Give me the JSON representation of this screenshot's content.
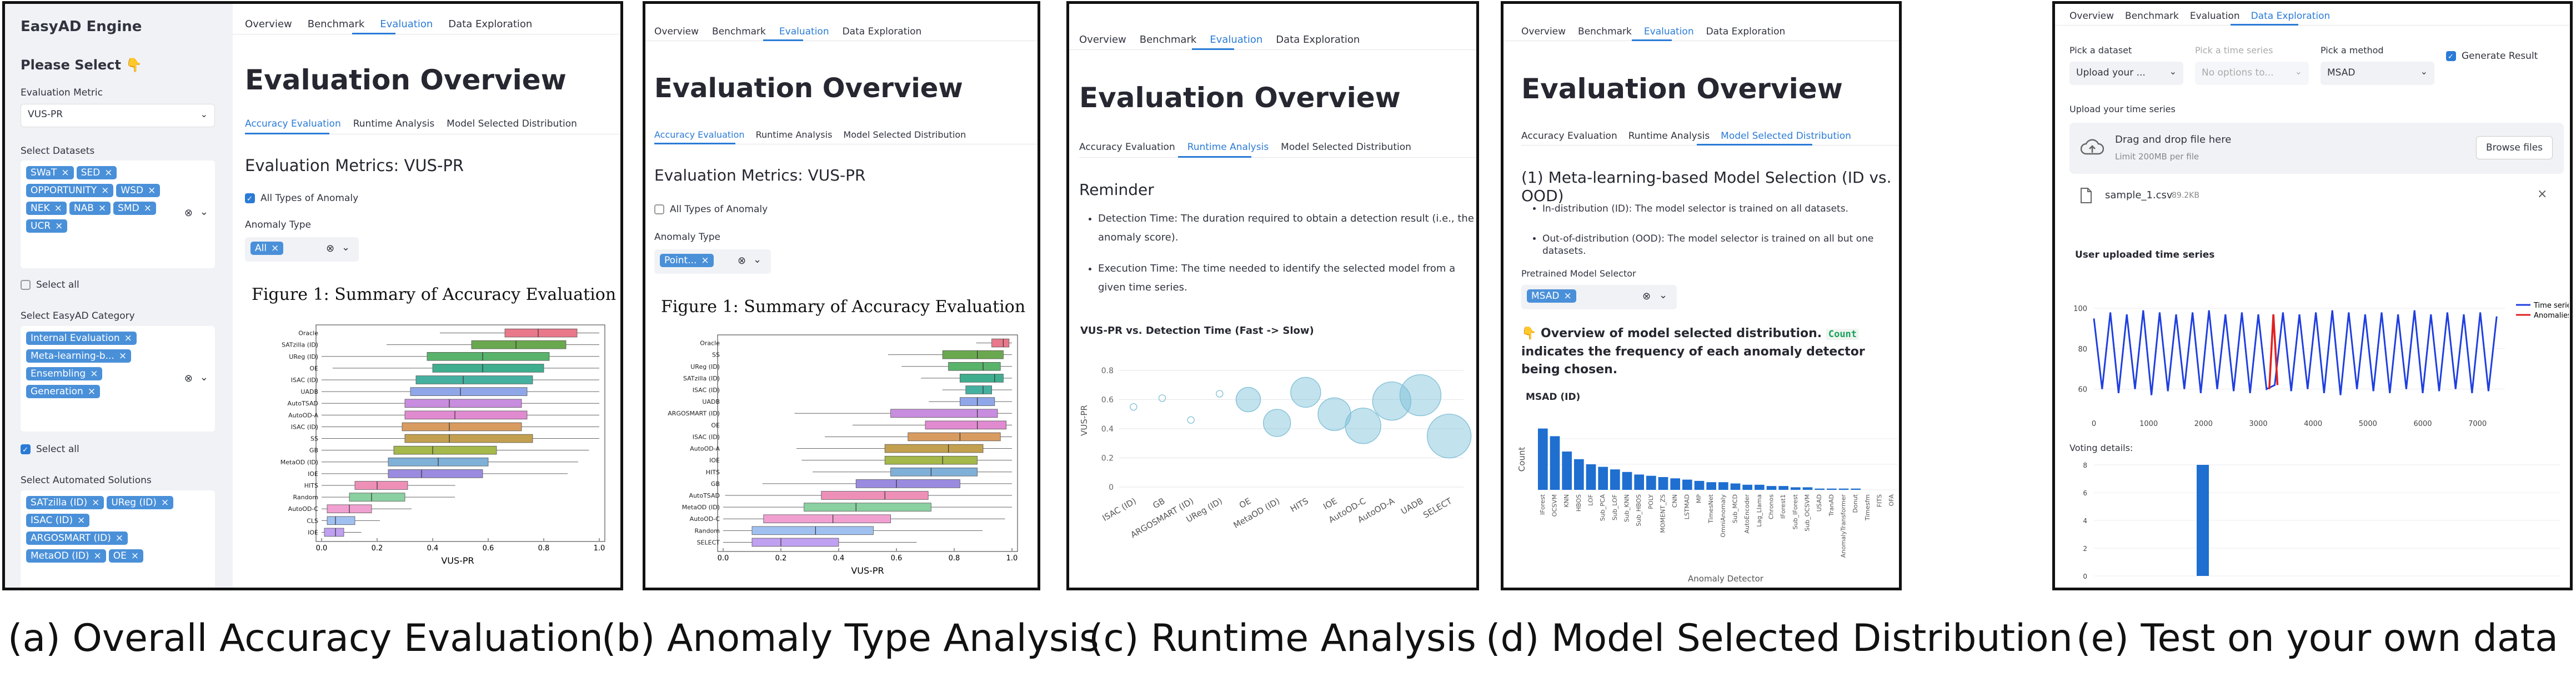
{
  "common": {
    "nav": [
      "Overview",
      "Benchmark",
      "Evaluation",
      "Data Exploration"
    ],
    "page_title": "Evaluation Overview",
    "tabs": [
      "Accuracy Evaluation",
      "Runtime Analysis",
      "Model Selected Distribution"
    ],
    "figure_title": "Figure 1: Summary of Accuracy Evaluation",
    "x_axis_label": "VUS-PR"
  },
  "captions": [
    "(a) Overall Accuracy Evaluation",
    "(b) Anomaly Type Analysis",
    "(c) Runtime Analysis",
    "(d) Model Selected Distribution",
    "(e) Test on your own data"
  ],
  "panel_a": {
    "sidebar": {
      "app_title": "EasyAD Engine",
      "please_select": "Please Select 👇",
      "metric_label": "Evaluation Metric",
      "metric_value": "VUS-PR",
      "datasets_label": "Select Datasets",
      "datasets": [
        "SWaT",
        "SED",
        "OPPORTUNITY",
        "WSD",
        "NEK",
        "NAB",
        "SMD",
        "UCR"
      ],
      "select_all": "Select all",
      "category_label": "Select EasyAD Category",
      "categories": [
        "Internal Evaluation",
        "Meta-learning-b...",
        "Ensembling",
        "Generation"
      ],
      "solutions_label": "Select Automated Solutions",
      "solutions": [
        "SATzilla (ID)",
        "UReg (ID)",
        "ISAC (ID)",
        "ARGOSMART (ID)",
        "MetaOD (ID)",
        "OE"
      ]
    },
    "metrics_title": "Evaluation Metrics: VUS-PR",
    "all_types": "All Types of Anomaly",
    "anomaly_type_label": "Anomaly Type",
    "anomaly_type_value": "All",
    "x_ticks": [
      "0.0",
      "0.2",
      "0.4",
      "0.6",
      "0.8",
      "1.0"
    ]
  },
  "panel_b": {
    "metrics_title": "Evaluation Metrics: VUS-PR",
    "all_types": "All Types of Anomaly",
    "anomaly_type_label": "Anomaly Type",
    "anomaly_type_value": "Point...",
    "x_ticks": [
      "0.0",
      "0.2",
      "0.4",
      "0.6",
      "0.8",
      "1.0"
    ]
  },
  "panel_c": {
    "reminder_title": "Reminder",
    "bullets": [
      "Detection Time: The duration required to obtain a detection result (i.e., the anomaly score).",
      "Execution Time: The time needed to identify the selected model from a given time series."
    ],
    "chart_title": "VUS-PR vs. Detection Time (Fast -> Slow)",
    "y_label": "VUS-PR",
    "y_ticks": [
      "0",
      "0.2",
      "0.4",
      "0.6",
      "0.8"
    ],
    "x_labels": [
      "ISAC (ID)",
      "GB",
      "ARGOSMART (ID)",
      "UReg (ID)",
      "OE",
      "MetaOD (ID)",
      "HITS",
      "IOE",
      "AutoOD-C",
      "AutoOD-A",
      "UADB",
      "SELECT"
    ]
  },
  "panel_d": {
    "section_title": "(1) Meta-learning-based Model Selection (ID vs. OOD)",
    "bullets": [
      "In-distribution (ID): The model selector is trained on all datasets.",
      "Out-of-distribution (OOD): The model selector is trained on all but one datasets."
    ],
    "selector_label": "Pretrained Model Selector",
    "selector_value": "MSAD",
    "overview_pre": "👇 Overview of model selected distribution.",
    "overview_code": "Count",
    "overview_post": "indicates the frequency of each anomaly detector being chosen.",
    "chart_title": "MSAD (ID)",
    "y_label": "Count",
    "x_label": "Anomaly Detector"
  },
  "panel_e": {
    "nav_active": "Data Exploration",
    "pick_dataset_label": "Pick a dataset",
    "pick_dataset_value": "Upload your ...",
    "pick_time_series_label": "Pick a time series",
    "pick_time_series_value": "No options to...",
    "pick_method_label": "Pick a method",
    "pick_method_value": "MSAD",
    "generate_result": "Generate Result",
    "upload_label": "Upload your time series",
    "drag_text": "Drag and drop file here",
    "limit_text": "Limit 200MB per file",
    "browse_button": "Browse files",
    "file_name": "sample_1.csv",
    "file_size": "89.2KB",
    "ts_title": "User uploaded time series",
    "legend_ts": "Time series",
    "legend_anom": "Anomalies",
    "ts_y_ticks": [
      "100",
      "80",
      "60"
    ],
    "ts_x_ticks": [
      "0",
      "1000",
      "2000",
      "3000",
      "4000",
      "5000",
      "6000",
      "7000"
    ],
    "voting_label": "Voting details:",
    "vote_y_ticks": [
      "8",
      "6",
      "4",
      "2",
      "0"
    ]
  },
  "chart_data": [
    {
      "type": "box",
      "title": "Figure 1: Summary of Accuracy Evaluation",
      "xlabel": "VUS-PR",
      "xlim": [
        0,
        1
      ],
      "categories": [
        "Oracle",
        "SATzilla (ID)",
        "UReg (ID)",
        "OE",
        "ISAC (ID)",
        "UADB",
        "AutoTSAD",
        "AutoOD-A",
        "ISAC (ID)",
        "SS",
        "GB",
        "MetaOD (ID)",
        "IOE",
        "HITS",
        "Random",
        "AutoOD-C",
        "CLS",
        "IOE"
      ],
      "q1": [
        0.66,
        0.54,
        0.38,
        0.4,
        0.34,
        0.32,
        0.3,
        0.3,
        0.29,
        0.3,
        0.26,
        0.24,
        0.24,
        0.12,
        0.1,
        0.02,
        0.02,
        0.01
      ],
      "median": [
        0.78,
        0.7,
        0.58,
        0.58,
        0.51,
        0.5,
        0.46,
        0.48,
        0.46,
        0.46,
        0.4,
        0.42,
        0.36,
        0.2,
        0.18,
        0.1,
        0.05,
        0.05
      ],
      "q3": [
        0.92,
        0.88,
        0.82,
        0.8,
        0.76,
        0.74,
        0.72,
        0.74,
        0.72,
        0.76,
        0.63,
        0.6,
        0.58,
        0.31,
        0.3,
        0.18,
        0.12,
        0.08
      ]
    },
    {
      "type": "box",
      "title": "Figure 1: Summary of Accuracy Evaluation",
      "xlabel": "VUS-PR",
      "xlim": [
        0,
        1
      ],
      "categories": [
        "Oracle",
        "SS",
        "UReg (ID)",
        "SATzilla (ID)",
        "ISAC (ID)",
        "UADB",
        "ARGOSMART (ID)",
        "OE",
        "ISAC (ID)",
        "AutoOD-A",
        "IOE",
        "HITS",
        "GB",
        "AutoTSAD",
        "MetaOD (ID)",
        "AutoOD-C",
        "Random",
        "SELECT"
      ],
      "q1": [
        0.93,
        0.76,
        0.78,
        0.82,
        0.84,
        0.82,
        0.58,
        0.7,
        0.64,
        0.56,
        0.56,
        0.58,
        0.46,
        0.34,
        0.28,
        0.14,
        0.1,
        0.1
      ],
      "median": [
        0.97,
        0.88,
        0.9,
        0.94,
        0.9,
        0.88,
        0.88,
        0.88,
        0.82,
        0.78,
        0.76,
        0.72,
        0.6,
        0.56,
        0.46,
        0.38,
        0.32,
        0.2
      ],
      "q3": [
        0.99,
        0.97,
        0.96,
        0.97,
        0.93,
        0.94,
        0.95,
        0.98,
        0.96,
        0.9,
        0.88,
        0.88,
        0.82,
        0.71,
        0.72,
        0.58,
        0.52,
        0.4
      ]
    },
    {
      "type": "scatter",
      "title": "VUS-PR vs. Detection Time (Fast -> Slow)",
      "ylabel": "VUS-PR",
      "ylim": [
        0,
        0.8
      ],
      "categories": [
        "ISAC (ID)",
        "GB",
        "ARGOSMART (ID)",
        "UReg (ID)",
        "OE",
        "MetaOD (ID)",
        "HITS",
        "IOE",
        "AutoOD-C",
        "AutoOD-A",
        "UADB",
        "SELECT"
      ],
      "values": [
        0.55,
        0.61,
        0.46,
        0.64,
        0.6,
        0.44,
        0.65,
        0.5,
        0.42,
        0.59,
        0.63,
        0.35
      ]
    },
    {
      "type": "bar",
      "title": "MSAD (ID)",
      "ylabel": "Count",
      "xlabel": "Anomaly Detector",
      "categories": [
        "IForest",
        "OCSVM",
        "KNN",
        "HBOS",
        "LOF",
        "Sub_PCA",
        "Sub_LOF",
        "Sub_KNN",
        "Sub_HBOS",
        "POLY",
        "MOMENT_ZS",
        "CNN",
        "LSTMAD",
        "MP",
        "TimesNet",
        "OmniAnomaly",
        "Sub_MCD",
        "AutoEncoder",
        "Lag_Llama",
        "Chronos",
        "IForest1",
        "Sub_IForest",
        "Sub_OCSVM",
        "USAD",
        "TranAD",
        "AnomalyTransformer",
        "Donut",
        "Timesfm",
        "FITS",
        "OFA"
      ],
      "values": [
        48,
        42,
        30,
        24,
        20,
        18,
        16,
        14,
        12,
        11,
        10,
        9,
        8,
        7,
        6,
        6,
        5,
        4,
        4,
        3,
        3,
        2,
        2,
        1,
        1,
        1,
        1,
        0,
        0,
        0
      ]
    },
    {
      "type": "line",
      "title": "User uploaded time series",
      "series": [
        {
          "name": "Time series"
        },
        {
          "name": "Anomalies"
        }
      ],
      "xlim": [
        0,
        7500
      ],
      "ylim": [
        50,
        105
      ],
      "anomaly_x_range": [
        3200,
        3350
      ],
      "x": [
        0,
        150,
        300,
        450,
        600,
        750,
        900,
        1050,
        1200,
        1350,
        1500,
        1650,
        1800,
        1950,
        2100,
        2250,
        2400,
        2550,
        2700,
        2850,
        3000,
        3150,
        3300,
        3450,
        3600,
        3750,
        3900,
        4050,
        4200,
        4350,
        4500,
        4650,
        4800,
        4950,
        5100,
        5250,
        5400,
        5550,
        5700,
        5850,
        6000,
        6150,
        6300,
        6450,
        6600,
        6750,
        6900,
        7050,
        7200,
        7350
      ],
      "values": [
        95,
        60,
        98,
        58,
        97,
        60,
        99,
        57,
        98,
        59,
        97,
        60,
        98,
        58,
        99,
        60,
        97,
        59,
        98,
        58,
        97,
        60,
        62,
        98,
        59,
        97,
        60,
        98,
        58,
        99,
        57,
        98,
        60,
        97,
        59,
        98,
        58,
        97,
        60,
        99,
        58,
        97,
        59,
        98,
        60,
        97,
        58,
        98,
        59,
        96
      ]
    },
    {
      "type": "bar",
      "title": "Voting details:",
      "ylim": [
        0,
        8
      ],
      "values": [
        8
      ]
    }
  ]
}
